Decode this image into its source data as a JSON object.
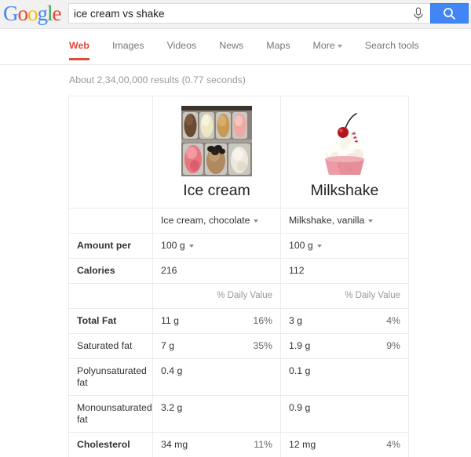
{
  "brand": {
    "logo_letters": [
      {
        "char": "G",
        "color": "#4285f4"
      },
      {
        "char": "o",
        "color": "#ea4335"
      },
      {
        "char": "o",
        "color": "#fbbc05"
      },
      {
        "char": "g",
        "color": "#4285f4"
      },
      {
        "char": "l",
        "color": "#34a853"
      },
      {
        "char": "e",
        "color": "#ea4335"
      }
    ]
  },
  "search": {
    "query": "ice cream vs shake",
    "placeholder": "Search",
    "mic_icon": "microphone-icon",
    "button_icon": "search-icon",
    "button_color": "#4285f4"
  },
  "nav": {
    "tabs": [
      {
        "label": "Web",
        "active": true
      },
      {
        "label": "Images",
        "active": false
      },
      {
        "label": "Videos",
        "active": false
      },
      {
        "label": "News",
        "active": false
      },
      {
        "label": "Maps",
        "active": false
      },
      {
        "label": "More",
        "active": false,
        "has_caret": true
      }
    ],
    "search_tools": "Search tools",
    "active_color": "#dd4b39"
  },
  "stats": {
    "text": "About 2,34,00,000 results (0.77 seconds)"
  },
  "comparison": {
    "items": [
      {
        "title": "Ice cream",
        "image": "ice-cream-tubs-photo",
        "variant": "Ice cream, chocolate",
        "amount": "100 g",
        "calories": "216",
        "daily_value_header": "% Daily Value"
      },
      {
        "title": "Milkshake",
        "image": "milkshake-cup-photo",
        "variant": "Milkshake, vanilla",
        "amount": "100 g",
        "calories": "112",
        "daily_value_header": "% Daily Value"
      }
    ],
    "rows": [
      {
        "label": "Amount per",
        "bold": true,
        "type": "amount",
        "values": [
          "100 g",
          "100 g"
        ],
        "percents": [
          "",
          ""
        ]
      },
      {
        "label": "Calories",
        "bold": true,
        "type": "plain",
        "values": [
          "216",
          "112"
        ],
        "percents": [
          "",
          ""
        ]
      },
      {
        "label": "",
        "bold": false,
        "type": "header",
        "values": [
          "",
          ""
        ],
        "percents": [
          "% Daily Value",
          "% Daily Value"
        ]
      },
      {
        "label": "Total Fat",
        "bold": true,
        "type": "plain",
        "values": [
          "11 g",
          "3 g"
        ],
        "percents": [
          "16%",
          "4%"
        ]
      },
      {
        "label": "Saturated fat",
        "bold": false,
        "type": "plain",
        "values": [
          "7 g",
          "1.9 g"
        ],
        "percents": [
          "35%",
          "9%"
        ]
      },
      {
        "label": "Polyunsaturated fat",
        "bold": false,
        "type": "plain",
        "values": [
          "0.4 g",
          "0.1 g"
        ],
        "percents": [
          "",
          ""
        ]
      },
      {
        "label": "Monounsaturated fat",
        "bold": false,
        "type": "plain",
        "values": [
          "3.2 g",
          "0.9 g"
        ],
        "percents": [
          "",
          ""
        ]
      },
      {
        "label": "Cholesterol",
        "bold": true,
        "type": "plain",
        "values": [
          "34 mg",
          "12 mg"
        ],
        "percents": [
          "11%",
          "4%"
        ]
      }
    ]
  }
}
